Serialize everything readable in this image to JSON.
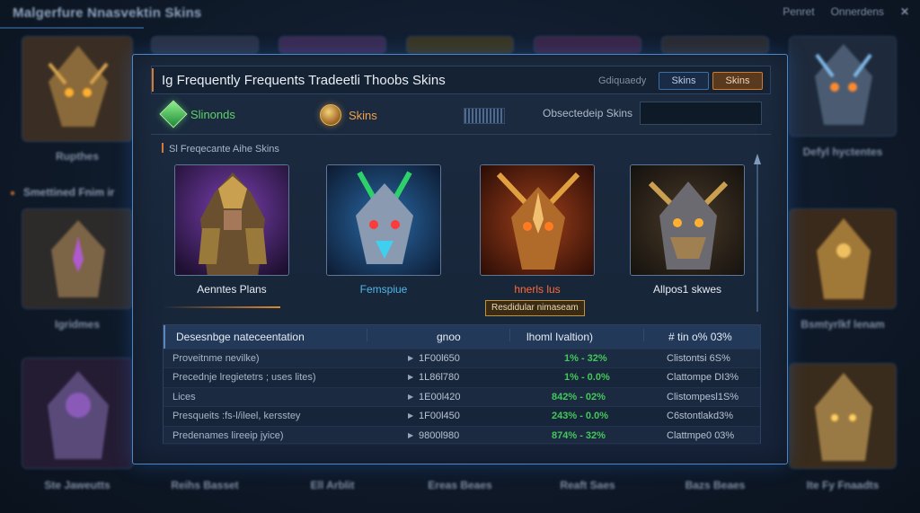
{
  "app": {
    "title": "Malgerfure Nnasvektin Skins",
    "top_right": [
      "Penret",
      "Onnerdens"
    ],
    "close_icon": "close-icon"
  },
  "background": {
    "side_heading": "Smettined Fnim ir",
    "left_labels": [
      "Rupthes",
      "Igridmes",
      "Ste Jaweutts"
    ],
    "right_labels": [
      "Defyl hyctentes",
      "Bsmtyrlkf lenam",
      "Ite Fy Fnaadts"
    ],
    "bottom_labels": [
      "Reihs Basset",
      "Ell Arblit",
      "Ereas Beaes",
      "Reaft Saes",
      "Bazs Beaes"
    ]
  },
  "modal": {
    "title": "Ig Frequently Frequents Tradeetli Thoobs Skins",
    "header_caption": "Gdiquaedy",
    "tabs": [
      "Skins",
      "Skins"
    ],
    "filters": [
      {
        "label": "Slinonds",
        "icon": "green-gem-icon",
        "color": "#5fd36a"
      },
      {
        "label": "Skins",
        "icon": "gold-crest-icon",
        "color": "#f0a24a"
      }
    ],
    "search_label": "Obsectedeip Skins",
    "search_value": "",
    "section_label": "Sl Freqecante Aihe Skins",
    "skins": [
      {
        "name": "Aenntes Plans",
        "color": "#e6ecf4"
      },
      {
        "name": "Femspiue",
        "color": "#4fb7e8"
      },
      {
        "name": "hnerls lus",
        "color": "#ff6a3a"
      },
      {
        "name": "Allpos1 skwes",
        "color": "#e6ecf4"
      }
    ],
    "tooltip": "Resdidular nimaseam"
  },
  "table": {
    "headers": [
      "Desesnbge nateceentation",
      "gnoo",
      "lhoml Ivaltion)",
      "# tin o% 03%"
    ],
    "rows": [
      {
        "name": "Proveitnme nevilke)",
        "value": "1F00l650",
        "change": "1% - 32%",
        "rate": "Clistontsi 6S%"
      },
      {
        "name": "Precednje lregietetrs ; uses lites)",
        "value": "1L86l780",
        "change": "1% - 0.0%",
        "rate": "Clattompe DI3%"
      },
      {
        "name": "Lices",
        "value": "1E00l420",
        "change": "842% - 02%",
        "rate": "Clistompesl1S%"
      },
      {
        "name": "Presqueits :fs-l/ileel, kersstey",
        "value": "1F00l450",
        "change": "243% - 0.0%",
        "rate": "C6stontlakd3%"
      },
      {
        "name": "Predenames lireeip jyice)",
        "value": "9800l980",
        "change": "874% - 32%",
        "rate": "Clattmpe0 03%"
      }
    ]
  }
}
